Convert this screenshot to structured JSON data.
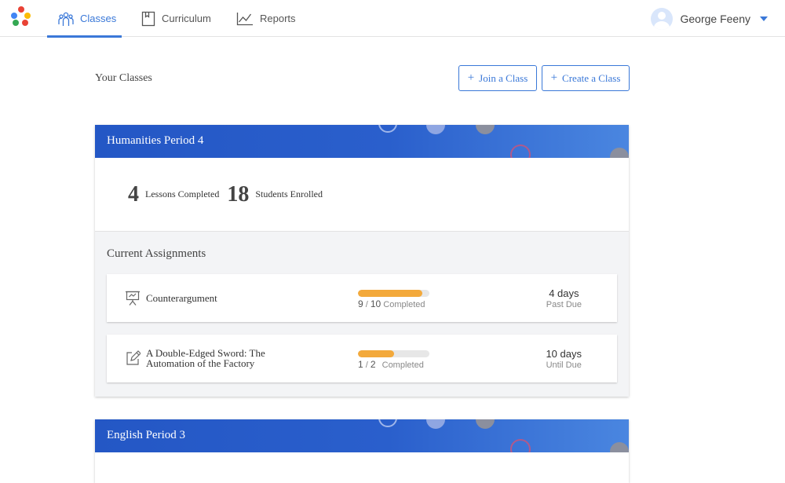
{
  "nav": {
    "tabs": [
      {
        "label": "Classes",
        "icon": "people-icon",
        "active": true
      },
      {
        "label": "Curriculum",
        "icon": "book-icon",
        "active": false
      },
      {
        "label": "Reports",
        "icon": "line-chart-icon",
        "active": false
      }
    ],
    "user_name": "George Feeny"
  },
  "page": {
    "title": "Your Classes",
    "join_label": "Join a Class",
    "create_label": "Create a Class"
  },
  "classes": [
    {
      "name": "Humanities Period 4",
      "lessons_completed": "4",
      "lessons_label": "Lessons Completed",
      "students_enrolled": "18",
      "students_label": "Students Enrolled",
      "assignments_title": "Current Assignments",
      "assignments": [
        {
          "name_line1": "Counterargument",
          "name_line2": "",
          "icon": "presentation-icon",
          "completed": "9",
          "total": "10",
          "completed_label": "Completed",
          "progress": 0.9,
          "due_value": "4 days",
          "due_label": "Past Due"
        },
        {
          "name_line1": "A Double-Edged Sword: The",
          "name_line2": "Automation of the Factory",
          "icon": "edit-icon",
          "completed": "1",
          "total": "2",
          "completed_label": "Completed",
          "progress": 0.5,
          "due_value": "10 days",
          "due_label": "Until Due"
        }
      ]
    },
    {
      "name": "English Period 3"
    }
  ],
  "colors": {
    "accent": "#3a78d8",
    "header_blue": "#2457c5",
    "progress": "#f3a93b"
  }
}
